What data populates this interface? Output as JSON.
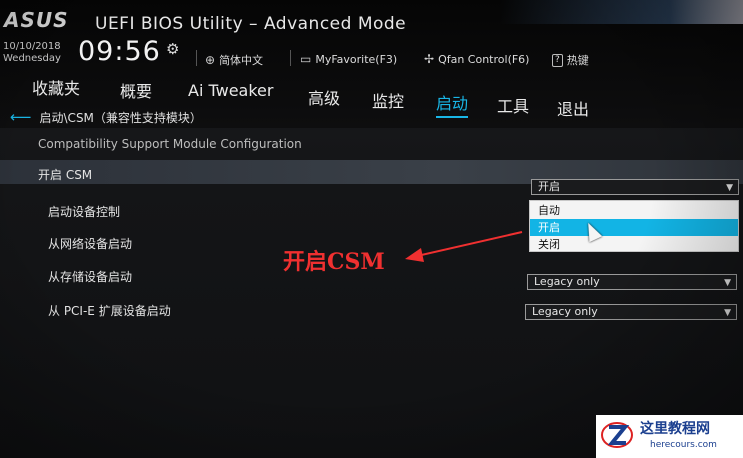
{
  "header": {
    "logo": "ASUS",
    "title": "UEFI BIOS Utility – Advanced Mode",
    "date": "10/10/2018",
    "weekday": "Wednesday",
    "time": "09:56",
    "toolbar": {
      "language": "简体中文",
      "favorite": "MyFavorite(F3)",
      "qfan": "Qfan Control(F6)",
      "hotkey_mark": "?",
      "hotkey": "热键"
    }
  },
  "menu": [
    "收藏夹",
    "概要",
    "Ai Tweaker",
    "高级",
    "监控",
    "启动",
    "工具",
    "退出"
  ],
  "menu_active": "启动",
  "breadcrumb": "启动\\CSM（兼容性支持模块）",
  "subtitle": "Compatibility Support Module Configuration",
  "settings": {
    "csm_label": "开启 CSM",
    "csm_value": "开启",
    "boot_device_label": "启动设备控制",
    "network_label": "从网络设备启动",
    "storage_label": "从存储设备启动",
    "storage_value": "Legacy only",
    "pcie_label": "从 PCI-E 扩展设备启动",
    "pcie_value": "Legacy only"
  },
  "dropdown_options": [
    "自动",
    "开启",
    "关闭"
  ],
  "dropdown_selected": "开启",
  "annotation": "开启CSM",
  "watermark": {
    "cn": "这里教程网",
    "url": "herecours.com"
  },
  "colors": {
    "accent": "#19b6e6",
    "annotation": "#f03030"
  }
}
